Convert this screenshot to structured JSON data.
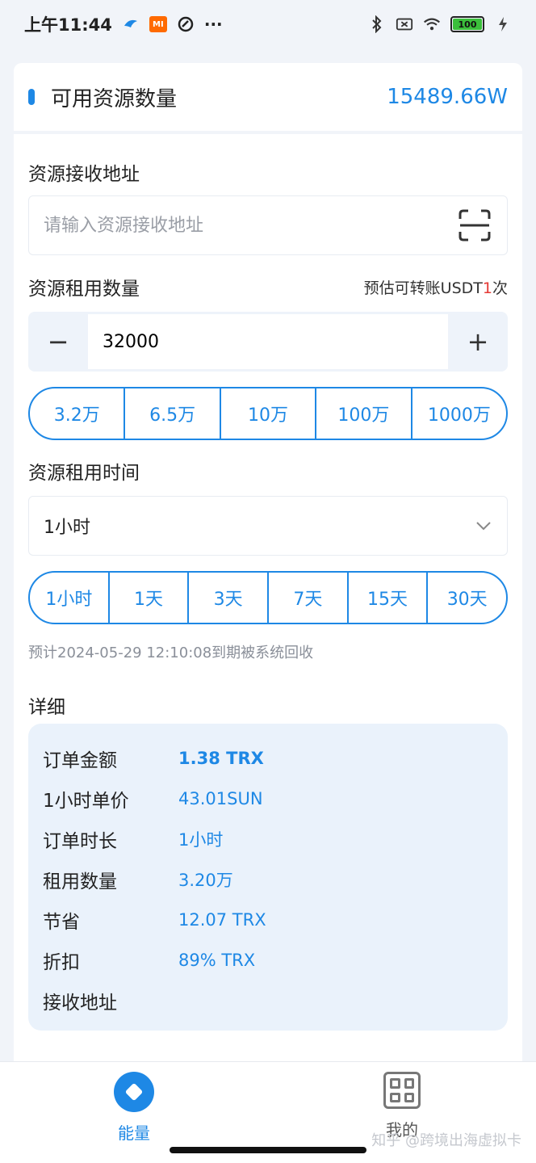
{
  "status_bar": {
    "time": "上午11:44",
    "mi_label": "MI",
    "more": "···",
    "battery": "100"
  },
  "resource": {
    "title": "可用资源数量",
    "value": "15489.66W"
  },
  "address": {
    "label": "资源接收地址",
    "placeholder": "请输入资源接收地址"
  },
  "amount": {
    "label": "资源租用数量",
    "hint_prefix": "预估可转账USDT",
    "hint_count": "1",
    "hint_suffix": "次",
    "minus": "−",
    "plus": "+",
    "value": "32000",
    "presets": [
      "3.2万",
      "6.5万",
      "10万",
      "100万",
      "1000万"
    ]
  },
  "duration": {
    "label": "资源租用时间",
    "selected": "1小时",
    "presets": [
      "1小时",
      "1天",
      "3天",
      "7天",
      "15天",
      "30天"
    ],
    "note": "预计2024-05-29 12:10:08到期被系统回收"
  },
  "detail": {
    "title": "详细",
    "rows": [
      {
        "key": "订单金额",
        "value": "1.38 TRX"
      },
      {
        "key": "1小时单价",
        "value": "43.01SUN"
      },
      {
        "key": "订单时长",
        "value": "1小时"
      },
      {
        "key": "租用数量",
        "value": "3.20万"
      },
      {
        "key": "节省",
        "value": "12.07 TRX"
      },
      {
        "key": "折扣",
        "value": "89% TRX"
      },
      {
        "key": "接收地址",
        "value": ""
      }
    ]
  },
  "nav": {
    "energy": "能量",
    "mine": "我的"
  },
  "watermark": "知乎 @跨境出海虚拟卡",
  "colors": {
    "accent": "#1e88e5",
    "highlight": "#e53935"
  },
  "icons": [
    "bluetooth-icon",
    "wifi-icon",
    "battery-icon",
    "scan-icon",
    "chevron-down-icon",
    "energy-icon",
    "grid-icon"
  ]
}
